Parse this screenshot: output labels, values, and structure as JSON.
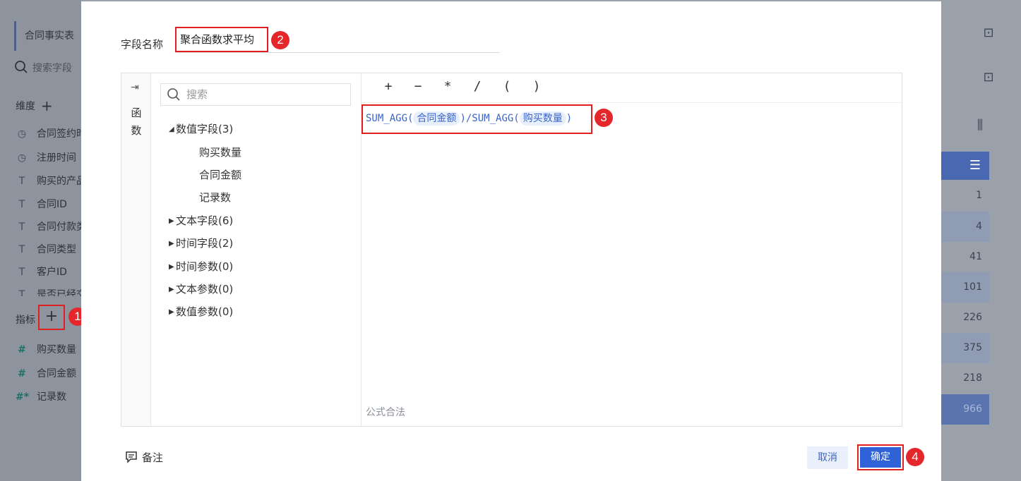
{
  "background": {
    "table_name": "合同事实表",
    "search_placeholder": "搜索字段",
    "dimension_label": "维度",
    "measure_label": "指标",
    "dimension_fields": [
      {
        "icon": "clock-icon",
        "label": "合同签约时间"
      },
      {
        "icon": "clock-icon",
        "label": "注册时间"
      },
      {
        "icon": "text-icon",
        "label": "购买的产品"
      },
      {
        "icon": "text-icon",
        "label": "合同ID"
      },
      {
        "icon": "text-icon",
        "label": "合同付款类型"
      },
      {
        "icon": "text-icon",
        "label": "合同类型"
      },
      {
        "icon": "text-icon",
        "label": "客户ID"
      },
      {
        "icon": "text-icon",
        "label": "是否已经交货"
      }
    ],
    "measure_fields": [
      {
        "icon": "number-icon",
        "label": "购买数量"
      },
      {
        "icon": "number-icon",
        "label": "合同金额"
      },
      {
        "icon": "number-calc-icon",
        "label": "记录数"
      }
    ],
    "table_values": [
      "1",
      "4",
      "41",
      "101",
      "226",
      "375",
      "218"
    ],
    "table_total": "966"
  },
  "dialog": {
    "field_name_label": "字段名称",
    "field_name_value": "聚合函数求平均",
    "side_tab_label": "函数",
    "tree_search_placeholder": "搜索",
    "tree": [
      {
        "label": "数值字段(3)",
        "expanded": true,
        "children": [
          "购买数量",
          "合同金额",
          "记录数"
        ]
      },
      {
        "label": "文本字段(6)",
        "expanded": false
      },
      {
        "label": "时间字段(2)",
        "expanded": false
      },
      {
        "label": "时间参数(0)",
        "expanded": false
      },
      {
        "label": "文本参数(0)",
        "expanded": false
      },
      {
        "label": "数值参数(0)",
        "expanded": false
      }
    ],
    "operators": [
      "+",
      "−",
      "*",
      "/",
      "(",
      ")"
    ],
    "formula": {
      "fn1": "SUM_AGG(",
      "arg1": "合同金额",
      "mid": ")/SUM_AGG(",
      "arg2": "购买数量",
      "end": ")"
    },
    "formula_status": "公式合法",
    "note_label": "备注",
    "cancel_label": "取消",
    "ok_label": "确定"
  },
  "markers": [
    "1",
    "2",
    "3",
    "4"
  ],
  "colors": {
    "accent": "#2f62d6",
    "highlight_red": "#e02020",
    "marker_red": "#e5262b"
  }
}
